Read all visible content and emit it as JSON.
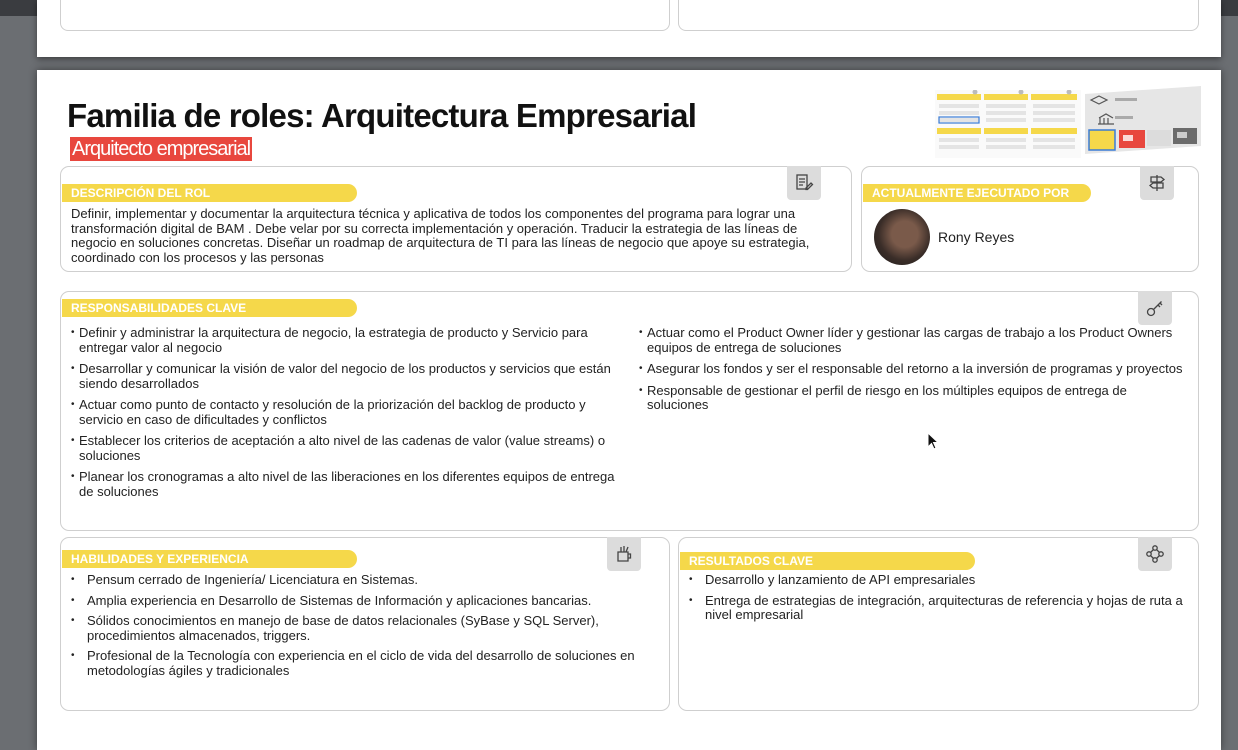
{
  "page": {
    "title": "Familia de roles: Arquitectura Empresarial",
    "subtitle": "Arquitecto empresarial"
  },
  "descripcion": {
    "heading": "DESCRIPCIÓN DEL ROL",
    "icon": "document-edit-icon",
    "text": "Definir, implementar y documentar la arquitectura técnica y aplicativa de todos los componentes del programa para lograr una transformación digital de BAM . Debe velar por su correcta implementación y operación. Traducir la estrategia de las líneas de negocio en soluciones concretas. Diseñar un roadmap de arquitectura de TI para las líneas de negocio que apoye su estrategia, coordinado con los procesos y las personas"
  },
  "ejecutado": {
    "heading": "ACTUALMENTE EJECUTADO POR",
    "icon": "signpost-icon",
    "person_name": "Rony Reyes"
  },
  "responsabilidades": {
    "heading": "RESPONSABILIDADES CLAVE",
    "icon": "key-icon",
    "left": [
      "Definir y administrar la arquitectura de negocio, la estrategia de producto y Servicio para entregar valor al negocio",
      "Desarrollar y comunicar la visión de valor del negocio de los productos y servicios que están siendo desarrollados",
      "Actuar como punto de contacto y resolución de la priorización del backlog de producto y servicio en caso de dificultades y conflictos",
      "Establecer los criterios de aceptación a alto nivel de las cadenas de valor (value streams) o soluciones",
      "Planear los cronogramas a alto nivel de las liberaciones en los diferentes equipos de entrega de soluciones"
    ],
    "right": [
      "Actuar como el Product Owner líder y gestionar las cargas de trabajo a los Product Owners equipos de entrega de soluciones",
      "Asegurar los fondos y ser el responsable del retorno a la inversión de programas y proyectos",
      "Responsable de gestionar el perfil de riesgo en los múltiples equipos de entrega de soluciones"
    ]
  },
  "habilidades": {
    "heading": "HABILIDADES Y EXPERIENCIA",
    "icon": "tools-cup-icon",
    "items": [
      "Pensum cerrado de Ingeniería/ Licenciatura en Sistemas.",
      "Amplia experiencia en Desarrollo de Sistemas de Información y aplicaciones bancarias.",
      "Sólidos conocimientos en manejo de base de datos relacionales (SyBase y SQL Server), procedimientos almacenados, triggers.",
      "Profesional de la Tecnología con experiencia en el ciclo de vida del desarrollo de soluciones en metodologías ágiles y tradicionales"
    ]
  },
  "resultados": {
    "heading": "RESULTADOS CLAVE",
    "icon": "network-nodes-icon",
    "items": [
      "Desarrollo y lanzamiento de API empresariales",
      "Entrega de estrategias de integración, arquitecturas de referencia y hojas de ruta a nivel empresarial"
    ]
  },
  "colors": {
    "accent_yellow": "#f5d84a",
    "accent_red": "#e8473e",
    "badge_gray": "#dcdcdc"
  }
}
